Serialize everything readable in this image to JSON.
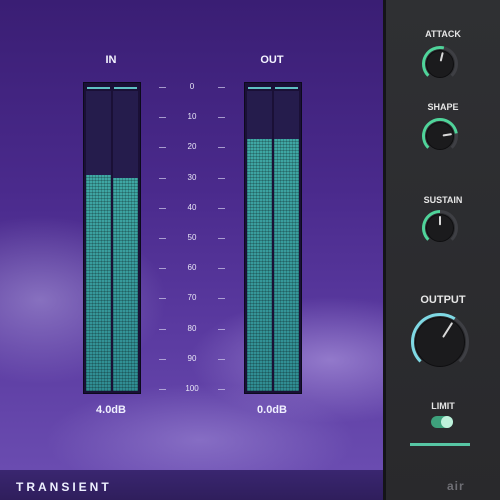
{
  "plugin": {
    "name": "TRANSIENT",
    "logo_text": "air"
  },
  "meters": {
    "in": {
      "label": "IN",
      "readout": "4.0dB",
      "left_level_pct": 72,
      "right_level_pct": 71
    },
    "out": {
      "label": "OUT",
      "readout": "0.0dB",
      "left_level_pct": 84,
      "right_level_pct": 84
    }
  },
  "scale": [
    "0",
    "10",
    "20",
    "30",
    "40",
    "50",
    "60",
    "70",
    "80",
    "90",
    "100"
  ],
  "controls": {
    "attack": {
      "label": "ATTACK",
      "level": 0.55,
      "accent": "#4fd49a"
    },
    "shape": {
      "label": "SHAPE",
      "level": 0.8,
      "accent": "#4fd49a"
    },
    "sustain": {
      "label": "SUSTAIN",
      "level": 0.5,
      "accent": "#4fd49a"
    },
    "output": {
      "label": "OUTPUT",
      "level": 0.62,
      "accent": "#7fd9e4"
    },
    "limit": {
      "label": "LIMIT",
      "enabled": true,
      "accent": "#4fd49a"
    }
  }
}
